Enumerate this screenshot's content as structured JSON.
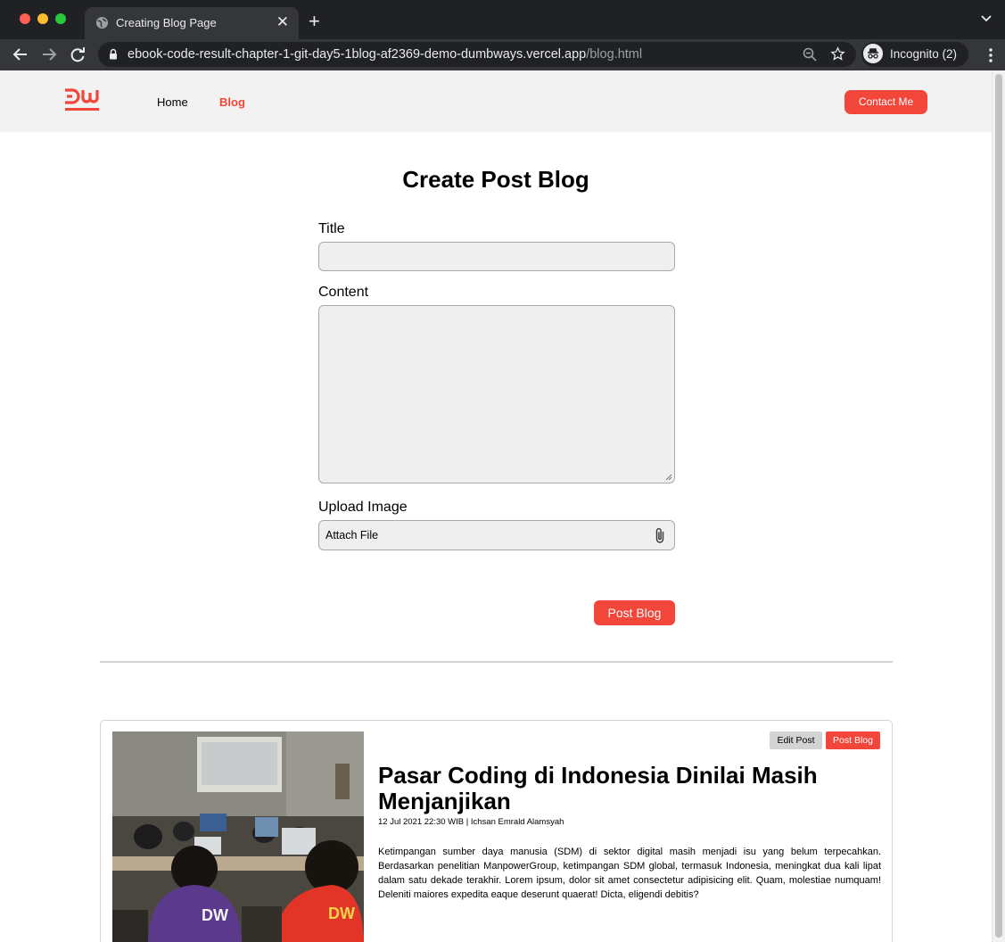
{
  "browser": {
    "tab_title": "Creating Blog Page",
    "url_host": "ebook-code-result-chapter-1-git-day5-1blog-af2369-demo-dumbways.vercel.app",
    "url_path": "/blog.html",
    "profile_label": "Incognito (2)"
  },
  "site": {
    "logo_label": "DUMBWAYS.ID",
    "nav": {
      "home": "Home",
      "blog": "Blog"
    },
    "contact_label": "Contact Me",
    "accent_color": "#f2463b"
  },
  "form": {
    "heading": "Create Post Blog",
    "title_label": "Title",
    "title_value": "",
    "content_label": "Content",
    "content_value": "",
    "upload_label": "Upload Image",
    "attach_label": "Attach File",
    "submit_label": "Post Blog"
  },
  "blog_post": {
    "edit_label": "Edit Post",
    "post_label": "Post Blog",
    "title": "Pasar Coding di Indonesia Dinilai Masih Menjanjikan",
    "meta": "12 Jul 2021 22:30 WIB | Ichsan Emrald Alamsyah",
    "body": "Ketimpangan sumber daya manusia (SDM) di sektor digital masih menjadi isu yang belum terpecahkan. Berdasarkan penelitian ManpowerGroup, ketimpangan SDM global, termasuk Indonesia, meningkat dua kali lipat dalam satu dekade terakhir. Lorem ipsum, dolor sit amet consectetur adipisicing elit. Quam, molestiae numquam! Deleniti maiores expedita eaque deserunt quaerat! Dicta, eligendi debitis?",
    "image_logo_text": "DW"
  }
}
